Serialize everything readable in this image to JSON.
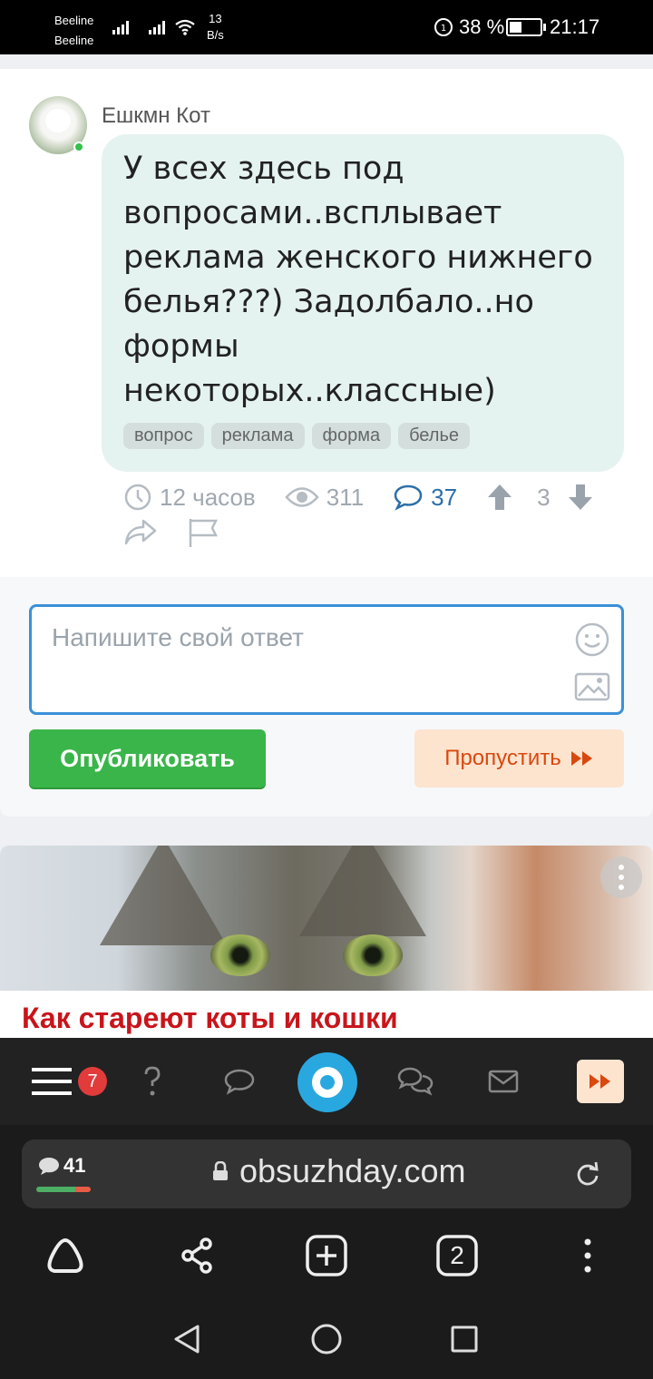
{
  "status_bar": {
    "carrier_1": "Beeline",
    "carrier_2": "Beeline",
    "net_speed_value": "13",
    "net_speed_unit": "B/s",
    "battery": "38 %",
    "time": "21:17"
  },
  "question": {
    "author": "Ешкмн Кот",
    "text": "У всех здесь под вопросами..всплывает реклама женского нижнего белья???) Задолбало..но формы некоторых..классные)",
    "tags": [
      "вопрос",
      "реклама",
      "форма",
      "белье"
    ],
    "time_ago": "12 часов",
    "views": "311",
    "comments": "37",
    "votes": "3"
  },
  "reply": {
    "placeholder": "Напишите свой ответ",
    "publish_label": "Опубликовать",
    "skip_label": "Пропустить"
  },
  "article": {
    "title": "Как стареют коты и кошки"
  },
  "site_nav": {
    "notifications_count": "7"
  },
  "browser": {
    "comments_count": "41",
    "url": "obsuzhday.com",
    "tabs_count": "2"
  },
  "colors": {
    "accent_blue": "#3a90d8",
    "publish_green": "#3ab54a",
    "skip_orange": "#d9480f",
    "article_red": "#c8151b",
    "logo_blue": "#29a8e0"
  }
}
